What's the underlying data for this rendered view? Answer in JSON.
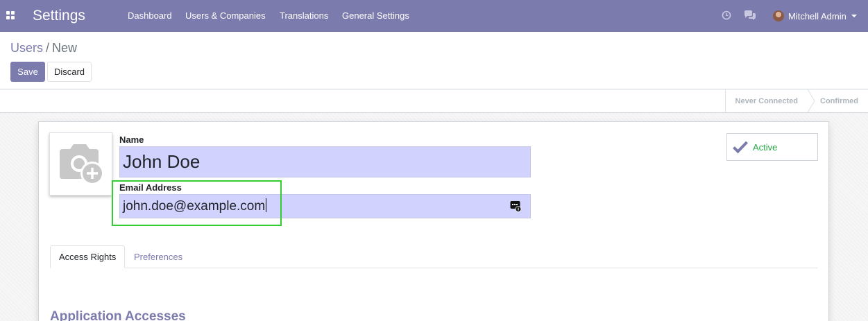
{
  "navbar": {
    "app_title": "Settings",
    "menu": [
      {
        "label": "Dashboard"
      },
      {
        "label": "Users & Companies"
      },
      {
        "label": "Translations"
      },
      {
        "label": "General Settings"
      }
    ],
    "user_name": "Mitchell Admin",
    "accent_color": "#7c7bad"
  },
  "breadcrumb": {
    "parent": "Users",
    "separator": "/",
    "current": "New"
  },
  "actions": {
    "save_label": "Save",
    "discard_label": "Discard"
  },
  "statusbar": {
    "steps": [
      {
        "label": "Never Connected"
      },
      {
        "label": "Confirmed"
      }
    ]
  },
  "form": {
    "name_label": "Name",
    "name_value": "John Doe",
    "email_label": "Email Address",
    "email_value": "john.doe@example.com",
    "active_label": "Active",
    "tabs": [
      {
        "label": "Access Rights"
      },
      {
        "label": "Preferences"
      }
    ],
    "section_title": "Application Accesses"
  },
  "icons": {
    "apps": "apps-grid-icon",
    "activity": "clock-icon",
    "messages": "chat-icon",
    "photo": "camera-plus-icon",
    "password_manager": "password-manager-icon",
    "active": "check-icon"
  }
}
